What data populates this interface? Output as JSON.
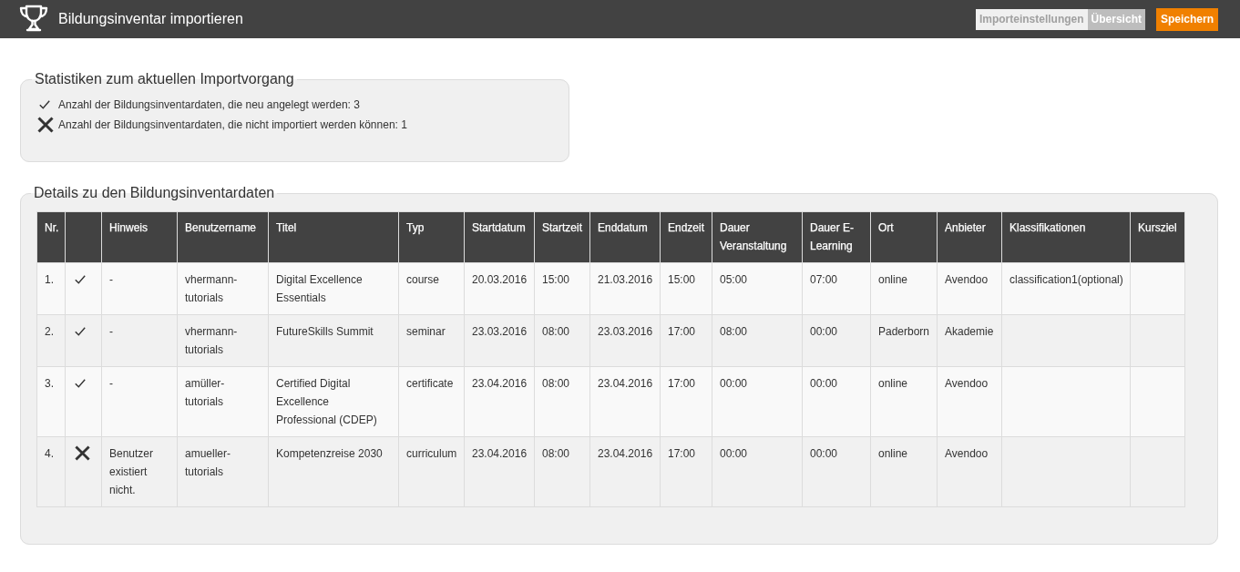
{
  "header": {
    "title": "Bildungsinventar importieren",
    "tabs": [
      {
        "label": "Importeinstellungen",
        "selected": false
      },
      {
        "label": "Übersicht",
        "selected": true
      }
    ],
    "save_button": "Speichern"
  },
  "statistics": {
    "title": "Statistiken zum aktuellen Importvorgang",
    "items": [
      {
        "kind": "success",
        "text": "Anzahl der Bildungsinventardaten, die neu angelegt werden: 3"
      },
      {
        "kind": "failure",
        "text": "Anzahl der Bildungsinventardaten, die nicht importiert werden können: 1"
      }
    ]
  },
  "details": {
    "title": "Details zu den Bildungsinventardaten",
    "table": {
      "columns": [
        {
          "kind": "text",
          "label": "Nr."
        },
        {
          "kind": "status"
        },
        {
          "kind": "text",
          "label": "Hinweis"
        },
        {
          "kind": "text",
          "label": "Benutzername"
        },
        {
          "kind": "text",
          "label": "Titel"
        },
        {
          "kind": "text",
          "label": "Typ"
        },
        {
          "kind": "text",
          "label": "Startdatum"
        },
        {
          "kind": "text",
          "label": "Startzeit"
        },
        {
          "kind": "text",
          "label": "Enddatum"
        },
        {
          "kind": "text",
          "label": "Endzeit"
        },
        {
          "kind": "text",
          "label": "Dauer Veranstaltung"
        },
        {
          "kind": "text",
          "label": "Dauer E-Learning"
        },
        {
          "kind": "text",
          "label": "Ort"
        },
        {
          "kind": "text",
          "label": "Anbieter"
        },
        {
          "kind": "text",
          "label": "Klassifikationen"
        },
        {
          "kind": "text",
          "label": "Kursziel"
        }
      ],
      "rows": [
        {
          "valid": true,
          "cells": [
            "1.",
            "",
            "-",
            "vhermann-tutorials",
            "Digital Excellence Essentials",
            "course",
            "20.03.2016",
            "15:00",
            "21.03.2016",
            "15:00",
            "05:00",
            "07:00",
            "online",
            "Avendoo",
            "classification1(optional)",
            ""
          ]
        },
        {
          "valid": true,
          "cells": [
            "2.",
            "",
            "-",
            "vhermann-tutorials",
            "FutureSkills Summit",
            "seminar",
            "23.03.2016",
            "08:00",
            "23.03.2016",
            "17:00",
            "08:00",
            "00:00",
            "Paderborn",
            "Akademie",
            "",
            ""
          ]
        },
        {
          "valid": true,
          "cells": [
            "3.",
            "",
            "-",
            "amüller-tutorials",
            "Certified Digital Excellence Professional (CDEP)",
            "certificate",
            "23.04.2016",
            "08:00",
            "23.04.2016",
            "17:00",
            "00:00",
            "00:00",
            "online",
            "Avendoo",
            "",
            ""
          ]
        },
        {
          "valid": false,
          "cells": [
            "4.",
            "",
            "Benutzer existiert nicht.",
            "amueller-tutorials",
            "Kompetenzreise 2030",
            "curriculum",
            "23.04.2016",
            "08:00",
            "23.04.2016",
            "17:00",
            "00:00",
            "00:00",
            "online",
            "Avendoo",
            "",
            ""
          ]
        }
      ]
    }
  }
}
